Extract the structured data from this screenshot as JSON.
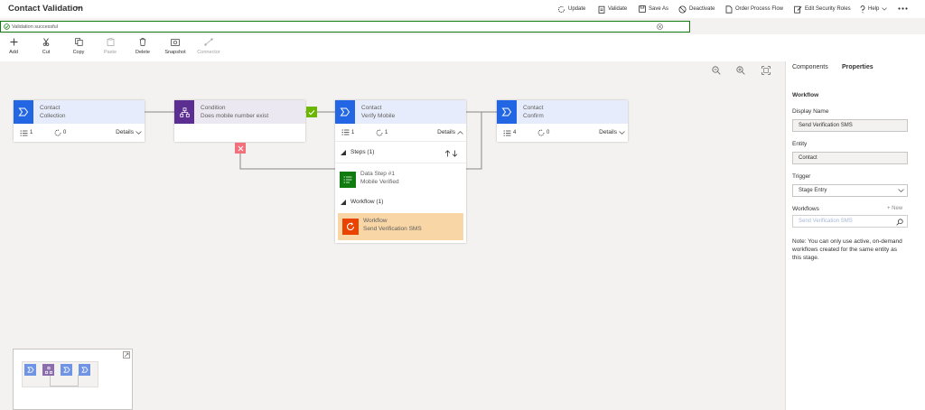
{
  "header": {
    "title": "Contact Validation",
    "commands": [
      {
        "icon": "refresh-icon",
        "label": "Update"
      },
      {
        "icon": "clipboard-icon",
        "label": "Validate"
      },
      {
        "icon": "save-icon",
        "label": "Save As"
      },
      {
        "icon": "deactivate-icon",
        "label": "Deactivate"
      },
      {
        "icon": "order-icon",
        "label": "Order Process Flow"
      },
      {
        "icon": "edit-icon",
        "label": "Edit Security Roles"
      },
      {
        "icon": "help-icon",
        "label": "Help"
      }
    ]
  },
  "notification": {
    "text": "Validation successful"
  },
  "toolbar": [
    {
      "label": "Add",
      "enabled": true
    },
    {
      "label": "Cut",
      "enabled": true
    },
    {
      "label": "Copy",
      "enabled": true
    },
    {
      "label": "Paste",
      "enabled": false
    },
    {
      "label": "Delete",
      "enabled": true
    },
    {
      "label": "Snapshot",
      "enabled": true
    },
    {
      "label": "Connector",
      "enabled": false
    }
  ],
  "stages": [
    {
      "line1": "Contact",
      "line2": "Collection",
      "steps": "1",
      "workflows": "0",
      "details": "Details"
    },
    {
      "line1": "Condition",
      "line2": "Does mobile number exist"
    },
    {
      "line1": "Contact",
      "line2": "Verify Mobile",
      "steps": "1",
      "workflows": "1",
      "details": "Details"
    },
    {
      "line1": "Contact",
      "line2": "Confirm",
      "steps": "4",
      "workflows": "0",
      "details": "Details"
    }
  ],
  "expanded": {
    "steps_header": "Steps (1)",
    "step": {
      "line1": "Data Step #1",
      "line2": "Mobile Verified"
    },
    "workflow_header": "Workflow (1)",
    "workflow": {
      "line1": "Workflow",
      "line2": "Send Verification SMS"
    }
  },
  "panel": {
    "tabs": [
      "Components",
      "Properties"
    ],
    "active_tab": "Properties",
    "section": "Workflow",
    "display_name_label": "Display Name",
    "display_name_value": "Send Verification SMS",
    "entity_label": "Entity",
    "entity_value": "Contact",
    "trigger_label": "Trigger",
    "trigger_value": "Stage Entry",
    "workflows_label": "Workflows",
    "new_link": "+ New",
    "workflow_search_value": "Send Verification SMS",
    "note": "Note: You can only use active, on-demand workflows created for the same entity as this stage."
  },
  "colors": {
    "stage_blue": "#2266e3",
    "condition_purple": "#5c2e91",
    "data_step_green": "#107c10",
    "workflow_orange": "#ea4300",
    "workflow_highlight": "#f8d6a6",
    "success_green": "#6bb700",
    "error_red": "#f1707b"
  }
}
